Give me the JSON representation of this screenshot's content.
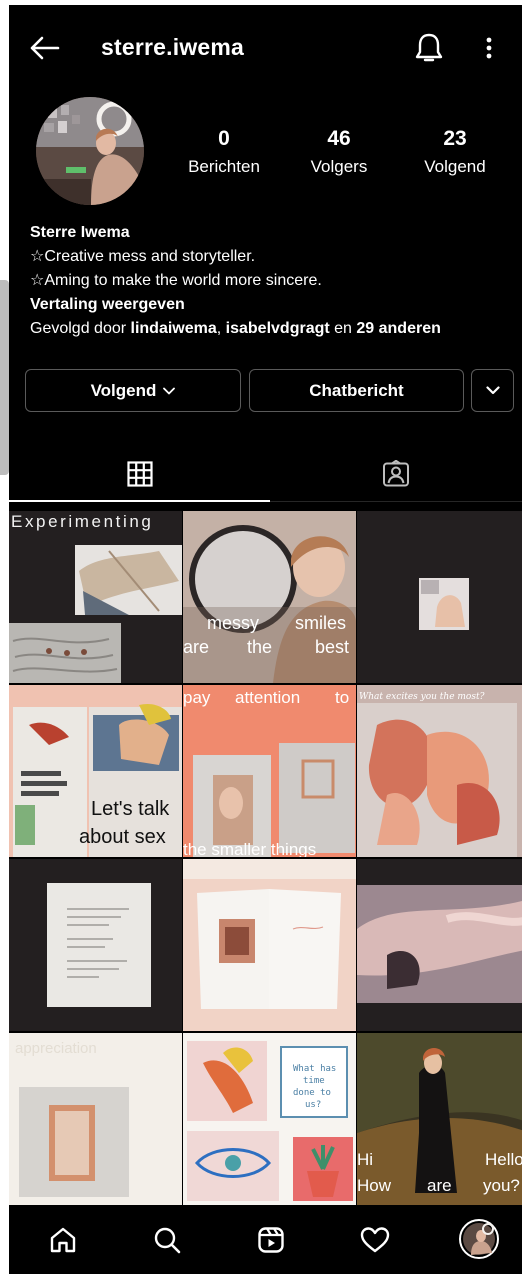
{
  "header": {
    "username": "sterre.iwema"
  },
  "profile": {
    "stats": [
      {
        "value": "0",
        "label": "Berichten"
      },
      {
        "value": "46",
        "label": "Volgers"
      },
      {
        "value": "23",
        "label": "Volgend"
      }
    ],
    "name": "Sterre Iwema",
    "bio_line1": "☆Creative mess and storyteller.",
    "bio_line2": "☆Aming to make the world more sincere.",
    "translate": "Vertaling weergeven",
    "followed_prefix": "Gevolgd door ",
    "followed_user1": "lindaiwema",
    "followed_sep": ", ",
    "followed_user2": "isabelvdgragt",
    "followed_and": " en ",
    "followed_others": "29 anderen"
  },
  "actions": {
    "following_label": "Volgend",
    "message_label": "Chatbericht"
  },
  "tabs": [
    {
      "icon": "grid-icon",
      "active": true
    },
    {
      "icon": "tagged-icon",
      "active": false
    }
  ],
  "posts": {
    "p1_text": "Experimenting",
    "p2_text_1": "messy",
    "p2_text_2": "smiles",
    "p2_text_3": "are",
    "p2_text_4": "the",
    "p2_text_5": "best",
    "p4_text_1": "Let's talk",
    "p4_text_2": "about sex",
    "p5_text_1": "pay",
    "p5_text_2": "attention",
    "p5_text_3": "to",
    "p5_text_4": "the smaller things",
    "p6_text": "What excites you the most?",
    "p10_text": "appreciation",
    "p11_text_1": "What has",
    "p11_text_2": "time",
    "p11_text_3": "done to",
    "p11_text_4": "us?",
    "p12_text_1": "Hi",
    "p12_text_2": "Hello",
    "p12_text_3": "How",
    "p12_text_4": "are",
    "p12_text_5": "you?"
  },
  "nav": [
    "home-icon",
    "search-icon",
    "reels-icon",
    "heart-icon",
    "profile-avatar"
  ],
  "colors": {
    "background": "#000000",
    "text": "#ffffff",
    "border": "#5a5a5a",
    "salmon": "#f08a6e",
    "dark_tile": "#231f20"
  }
}
